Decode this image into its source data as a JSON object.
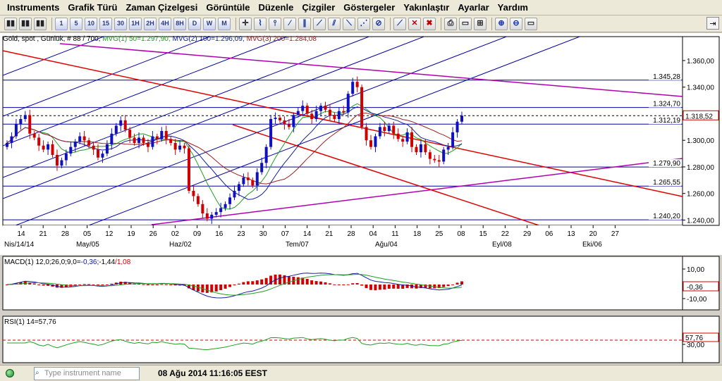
{
  "menu": [
    "Instruments",
    "Grafik Türü",
    "Zaman Çizelgesi",
    "Görüntüle",
    "Düzenle",
    "Çizgiler",
    "Göstergeler",
    "Yakınlaştır",
    "Ayarlar",
    "Yardım"
  ],
  "toolbar": {
    "timeframes": [
      "1",
      "5",
      "10",
      "15",
      "30",
      "1H",
      "2H",
      "4H",
      "8H",
      "D",
      "W",
      "M"
    ]
  },
  "main_chart": {
    "header": "Gold, spot , Günlük, # 88 / 700, ",
    "ma1": "MVG(1) 50=1.297,90,",
    "ma2": "MVG(2) 100=1.296,09,",
    "ma3": "MVG(3) 200=1.284,08",
    "y_ticks": [
      "1.360,00",
      "1.340,00",
      "1.320,00",
      "1.300,00",
      "1.280,00",
      "1.260,00",
      "1.240,00"
    ],
    "level_labels": [
      "1.345,28",
      "1.324,70",
      "1.312,19",
      "1.279,90",
      "1.265,55",
      "1.240,20"
    ],
    "current_price": "1.318,52",
    "x_ticks": [
      "14",
      "21",
      "28",
      "05",
      "12",
      "19",
      "26",
      "02",
      "09",
      "16",
      "23",
      "30",
      "07",
      "14",
      "21",
      "28",
      "04",
      "11",
      "18",
      "25",
      "08",
      "15",
      "22",
      "29",
      "06",
      "13",
      "20",
      "27"
    ],
    "month_labels": [
      "Nis/14/14",
      "May/05",
      "Haz/02",
      "Tem/07",
      "Ağu/04",
      "Eyl/08",
      "Eki/06"
    ]
  },
  "macd": {
    "label_prefix": "MACD(1) 12,0;26,0;9,0=",
    "val1": "-0,36",
    "val2": ";-1,44",
    "val3": "/1,08",
    "y_ticks": [
      "10,00",
      "-10,00"
    ],
    "current": "-0,36"
  },
  "rsi": {
    "label": "RSI(1) 14=57,76",
    "y_ticks": [
      "30,00"
    ],
    "current": "57,76"
  },
  "status": {
    "search_placeholder": "Type instrument name",
    "timestamp": "08 Ağu 2014 11:16:05 EEST"
  },
  "colors": {
    "up": "#1010c0",
    "down": "#d00000",
    "channel": "#0000a0",
    "magenta": "#b000b0",
    "red_trend": "#e00000",
    "ma1": "#20a020",
    "ma2": "#1020a0",
    "ma3": "#a02020"
  },
  "chart_data": {
    "type": "candlestick",
    "title": "Gold, spot , Günlük",
    "ylim": [
      1236,
      1378
    ],
    "y_ticks": [
      1360,
      1340,
      1320,
      1300,
      1280,
      1260,
      1240
    ],
    "horizontal_levels": [
      1345.28,
      1324.7,
      1312.19,
      1279.9,
      1265.55,
      1240.2
    ],
    "current_price": 1318.52,
    "closes": [
      1298,
      1303,
      1312,
      1316,
      1319,
      1305,
      1302,
      1296,
      1293,
      1297,
      1289,
      1281,
      1285,
      1290,
      1295,
      1299,
      1303,
      1300,
      1296,
      1293,
      1287,
      1290,
      1297,
      1305,
      1311,
      1315,
      1308,
      1302,
      1298,
      1302,
      1298,
      1295,
      1303,
      1301,
      1307,
      1301,
      1298,
      1293,
      1296,
      1294,
      1262,
      1258,
      1252,
      1245,
      1241,
      1244,
      1246,
      1249,
      1252,
      1257,
      1262,
      1267,
      1272,
      1270,
      1266,
      1276,
      1283,
      1295,
      1316,
      1317,
      1315,
      1312,
      1310,
      1319,
      1322,
      1326,
      1320,
      1316,
      1322,
      1326,
      1323,
      1319,
      1316,
      1322,
      1321,
      1335,
      1344,
      1340,
      1310,
      1300,
      1295,
      1303,
      1310,
      1307,
      1311,
      1305,
      1301,
      1299,
      1306,
      1295,
      1291,
      1297,
      1291,
      1286,
      1285,
      1284,
      1293,
      1295,
      1306,
      1314,
      1318.5
    ]
  }
}
